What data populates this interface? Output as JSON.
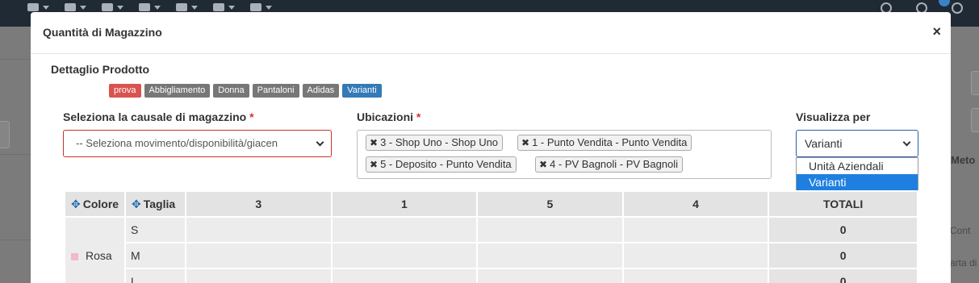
{
  "modal": {
    "title": "Quantità di Magazzino",
    "close_label": "×",
    "section_title": "Dettaglio Prodotto",
    "tags": [
      {
        "label": "prova",
        "color": "#d9534f"
      },
      {
        "label": "Abbigliamento",
        "color": "#777777"
      },
      {
        "label": "Donna",
        "color": "#777777"
      },
      {
        "label": "Pantaloni",
        "color": "#777777"
      },
      {
        "label": "Adidas",
        "color": "#777777"
      },
      {
        "label": "Varianti",
        "color": "#337ab7"
      }
    ]
  },
  "form": {
    "causale_label": "Seleziona la causale di magazzino",
    "causale_value": "-- Seleziona movimento/disponibilità/giacen",
    "ubicazioni_label": "Ubicazioni",
    "required_mark": "*",
    "ubicazioni_chips": [
      "3 - Shop Uno - Shop Uno",
      "1 - Punto Vendita - Punto Vendita",
      "5 - Deposito - Punto Vendita",
      "4 - PV Bagnoli - PV Bagnoli"
    ],
    "chip_remove_icon": "✖",
    "visualizza_label": "Visualizza per",
    "visualizza_value": "Varianti",
    "visualizza_options": [
      {
        "label": "Unità Aziendali",
        "selected": false
      },
      {
        "label": "Varianti",
        "selected": true
      }
    ]
  },
  "table": {
    "header_colore": "Colore",
    "header_taglia": "Taglia",
    "move_icon": "✥",
    "columns": [
      "3",
      "1",
      "5",
      "4",
      "TOTALI"
    ],
    "color_name": "Rosa",
    "color_swatch": "#f4b9c7",
    "rows": [
      {
        "taglia": "S",
        "totale": "0"
      },
      {
        "taglia": "M",
        "totale": "0"
      },
      {
        "taglia": "L",
        "totale": "0"
      }
    ]
  },
  "background": {
    "right_label_1": "Meto",
    "right_label_2": "Cont",
    "right_label_3": "arta di"
  }
}
